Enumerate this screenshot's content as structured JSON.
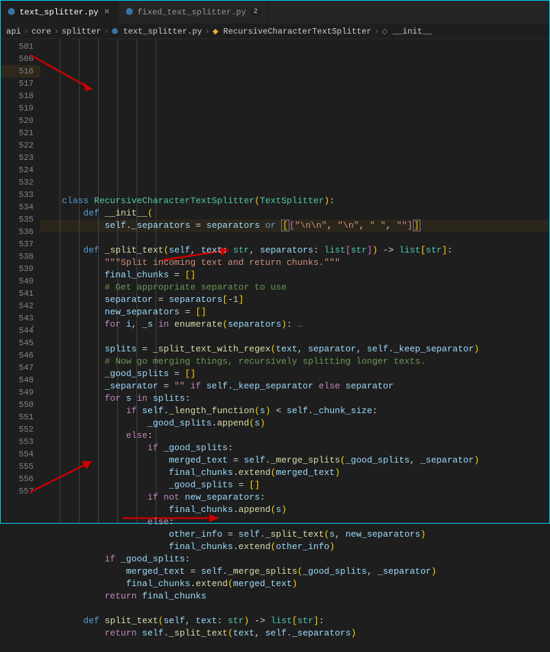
{
  "tabs": [
    {
      "label": "text_splitter.py",
      "active": true,
      "mod": null
    },
    {
      "label": "fixed_text_splitter.py",
      "active": false,
      "mod": "2"
    }
  ],
  "breadcrumbs": [
    {
      "label": "api",
      "icon": null
    },
    {
      "label": "core",
      "icon": null
    },
    {
      "label": "splitter",
      "icon": null
    },
    {
      "label": "text_splitter.py",
      "icon": "py"
    },
    {
      "label": "RecursiveCharacterTextSplitter",
      "icon": "cls"
    },
    {
      "label": "__init__",
      "icon": "fn"
    }
  ],
  "sep": "›",
  "lines": [
    {
      "num": "501",
      "tokens": [
        [
          "    ",
          ""
        ],
        [
          "class ",
          "kw"
        ],
        [
          "RecursiveCharacterTextSplitter",
          "cls"
        ],
        [
          "(",
          "par"
        ],
        [
          "TextSplitter",
          "cls"
        ],
        [
          ")",
          "par"
        ],
        [
          ":",
          "p"
        ]
      ]
    },
    {
      "num": "508",
      "tokens": [
        [
          "        ",
          ""
        ],
        [
          "def ",
          "kw"
        ],
        [
          "__init__",
          "fn"
        ],
        [
          "(",
          "par"
        ]
      ]
    },
    {
      "num": "516",
      "hl": true,
      "tokens": [
        [
          "            ",
          ""
        ],
        [
          "self",
          "v"
        ],
        [
          "._separators",
          "v"
        ],
        [
          " = ",
          "p"
        ],
        [
          "separators",
          "v"
        ],
        [
          " ",
          "p"
        ],
        [
          "or",
          "kw"
        ],
        [
          " ",
          "p"
        ],
        [
          "[",
          "par selbox"
        ],
        [
          "[",
          "par2"
        ],
        [
          "\"",
          "s"
        ],
        [
          "\\n\\n",
          "s"
        ],
        [
          "\"",
          "s"
        ],
        [
          ", ",
          "p"
        ],
        [
          "\"",
          "s"
        ],
        [
          "\\n",
          "s"
        ],
        [
          "\"",
          "s"
        ],
        [
          ", ",
          "p"
        ],
        [
          "\"",
          "s"
        ],
        [
          " ",
          "s"
        ],
        [
          "\"",
          "s"
        ],
        [
          ", ",
          "p"
        ],
        [
          "\"\"",
          "s"
        ],
        [
          "]",
          "par2"
        ],
        [
          "]",
          "par selbox"
        ]
      ]
    },
    {
      "num": "517",
      "tokens": [
        [
          "",
          ""
        ]
      ]
    },
    {
      "num": "518",
      "tokens": [
        [
          "        ",
          ""
        ],
        [
          "def ",
          "kw"
        ],
        [
          "_split_text",
          "fn"
        ],
        [
          "(",
          "par"
        ],
        [
          "self",
          "v"
        ],
        [
          ", ",
          "p"
        ],
        [
          "text",
          "v"
        ],
        [
          ": ",
          "p"
        ],
        [
          "str",
          "cls"
        ],
        [
          ", ",
          "p"
        ],
        [
          "separators",
          "v"
        ],
        [
          ": ",
          "p"
        ],
        [
          "list",
          "cls"
        ],
        [
          "[",
          "par2"
        ],
        [
          "str",
          "cls"
        ],
        [
          "]",
          "par2"
        ],
        [
          ")",
          "par"
        ],
        [
          " -> ",
          "p"
        ],
        [
          "list",
          "cls"
        ],
        [
          "[",
          "par"
        ],
        [
          "str",
          "cls"
        ],
        [
          "]",
          "par"
        ],
        [
          ":",
          "p"
        ]
      ]
    },
    {
      "num": "519",
      "tokens": [
        [
          "            ",
          ""
        ],
        [
          "\"\"\"Split incoming text and return chunks.\"\"\"",
          "s"
        ]
      ]
    },
    {
      "num": "520",
      "tokens": [
        [
          "            ",
          ""
        ],
        [
          "final_chunks",
          "v"
        ],
        [
          " = ",
          "p"
        ],
        [
          "[",
          "par"
        ],
        [
          "]",
          "par"
        ]
      ]
    },
    {
      "num": "521",
      "tokens": [
        [
          "            ",
          ""
        ],
        [
          "# Get appropriate separator to use",
          "c"
        ]
      ]
    },
    {
      "num": "522",
      "tokens": [
        [
          "            ",
          ""
        ],
        [
          "separator",
          "v"
        ],
        [
          " = ",
          "p"
        ],
        [
          "separators",
          "v"
        ],
        [
          "[",
          "par"
        ],
        [
          "-",
          "p"
        ],
        [
          "1",
          "n"
        ],
        [
          "]",
          "par"
        ]
      ]
    },
    {
      "num": "523",
      "tokens": [
        [
          "            ",
          ""
        ],
        [
          "new_separators",
          "v"
        ],
        [
          " = ",
          "p"
        ],
        [
          "[",
          "par"
        ],
        [
          "]",
          "par"
        ]
      ]
    },
    {
      "num": "524",
      "fold": true,
      "tokens": [
        [
          "            ",
          ""
        ],
        [
          "for ",
          "kwc"
        ],
        [
          "i",
          "v"
        ],
        [
          ", ",
          "p"
        ],
        [
          "_s",
          "v"
        ],
        [
          " ",
          "p"
        ],
        [
          "in ",
          "kwc"
        ],
        [
          "enumerate",
          "fn"
        ],
        [
          "(",
          "par"
        ],
        [
          "separators",
          "v"
        ],
        [
          ")",
          "par"
        ],
        [
          ": ",
          "p"
        ],
        [
          "…",
          "c"
        ]
      ]
    },
    {
      "num": "532",
      "tokens": [
        [
          "",
          ""
        ]
      ]
    },
    {
      "num": "533",
      "tokens": [
        [
          "            ",
          ""
        ],
        [
          "splits",
          "v"
        ],
        [
          " = ",
          "p"
        ],
        [
          "_split_text_with_regex",
          "fn"
        ],
        [
          "(",
          "par"
        ],
        [
          "text",
          "v"
        ],
        [
          ", ",
          "p"
        ],
        [
          "separator",
          "v"
        ],
        [
          ", ",
          "p"
        ],
        [
          "self",
          "v"
        ],
        [
          "._keep_separator",
          "v"
        ],
        [
          ")",
          "par"
        ]
      ]
    },
    {
      "num": "534",
      "tokens": [
        [
          "            ",
          ""
        ],
        [
          "# Now go merging things, recursively splitting longer texts.",
          "c"
        ]
      ]
    },
    {
      "num": "535",
      "tokens": [
        [
          "            ",
          ""
        ],
        [
          "_good_splits",
          "v"
        ],
        [
          " = ",
          "p"
        ],
        [
          "[",
          "par"
        ],
        [
          "]",
          "par"
        ]
      ]
    },
    {
      "num": "536",
      "tokens": [
        [
          "            ",
          ""
        ],
        [
          "_separator",
          "v"
        ],
        [
          " = ",
          "p"
        ],
        [
          "\"\"",
          "s"
        ],
        [
          " ",
          "p"
        ],
        [
          "if ",
          "kwc"
        ],
        [
          "self",
          "v"
        ],
        [
          "._keep_separator",
          "v"
        ],
        [
          " ",
          "p"
        ],
        [
          "else ",
          "kwc"
        ],
        [
          "separator",
          "v"
        ]
      ]
    },
    {
      "num": "537",
      "tokens": [
        [
          "            ",
          ""
        ],
        [
          "for ",
          "kwc"
        ],
        [
          "s",
          "v"
        ],
        [
          " ",
          "p"
        ],
        [
          "in ",
          "kwc"
        ],
        [
          "splits",
          "v"
        ],
        [
          ":",
          "p"
        ]
      ]
    },
    {
      "num": "538",
      "tokens": [
        [
          "                ",
          ""
        ],
        [
          "if ",
          "kwc"
        ],
        [
          "self",
          "v"
        ],
        [
          "._length_function",
          "fn"
        ],
        [
          "(",
          "par"
        ],
        [
          "s",
          "v"
        ],
        [
          ")",
          "par"
        ],
        [
          " < ",
          "p"
        ],
        [
          "self",
          "v"
        ],
        [
          "._chunk_size",
          "v"
        ],
        [
          ":",
          "p"
        ]
      ]
    },
    {
      "num": "539",
      "tokens": [
        [
          "                    ",
          ""
        ],
        [
          "_good_splits",
          "v"
        ],
        [
          ".",
          "p"
        ],
        [
          "append",
          "fn"
        ],
        [
          "(",
          "par"
        ],
        [
          "s",
          "v"
        ],
        [
          ")",
          "par"
        ]
      ]
    },
    {
      "num": "540",
      "tokens": [
        [
          "                ",
          ""
        ],
        [
          "else",
          "kwc"
        ],
        [
          ":",
          "p"
        ]
      ]
    },
    {
      "num": "541",
      "tokens": [
        [
          "                    ",
          ""
        ],
        [
          "if ",
          "kwc"
        ],
        [
          "_good_splits",
          "v"
        ],
        [
          ":",
          "p"
        ]
      ]
    },
    {
      "num": "542",
      "tokens": [
        [
          "                        ",
          ""
        ],
        [
          "merged_text",
          "v"
        ],
        [
          " = ",
          "p"
        ],
        [
          "self",
          "v"
        ],
        [
          ".",
          "p"
        ],
        [
          "_merge_splits",
          "fn"
        ],
        [
          "(",
          "par"
        ],
        [
          "_good_splits",
          "v"
        ],
        [
          ", ",
          "p"
        ],
        [
          "_separator",
          "v"
        ],
        [
          ")",
          "par"
        ]
      ]
    },
    {
      "num": "543",
      "tokens": [
        [
          "                        ",
          ""
        ],
        [
          "final_chunks",
          "v"
        ],
        [
          ".",
          "p"
        ],
        [
          "extend",
          "fn"
        ],
        [
          "(",
          "par"
        ],
        [
          "merged_text",
          "v"
        ],
        [
          ")",
          "par"
        ]
      ]
    },
    {
      "num": "544",
      "tokens": [
        [
          "                        ",
          ""
        ],
        [
          "_good_splits",
          "v"
        ],
        [
          " = ",
          "p"
        ],
        [
          "[",
          "par"
        ],
        [
          "]",
          "par"
        ]
      ]
    },
    {
      "num": "545",
      "tokens": [
        [
          "                    ",
          ""
        ],
        [
          "if ",
          "kwc"
        ],
        [
          "not ",
          "kwc"
        ],
        [
          "new_separators",
          "v"
        ],
        [
          ":",
          "p"
        ]
      ]
    },
    {
      "num": "546",
      "tokens": [
        [
          "                        ",
          ""
        ],
        [
          "final_chunks",
          "v"
        ],
        [
          ".",
          "p"
        ],
        [
          "append",
          "fn"
        ],
        [
          "(",
          "par"
        ],
        [
          "s",
          "v"
        ],
        [
          ")",
          "par"
        ]
      ]
    },
    {
      "num": "547",
      "tokens": [
        [
          "                    ",
          ""
        ],
        [
          "else",
          "kwc"
        ],
        [
          ":",
          "p"
        ]
      ]
    },
    {
      "num": "548",
      "tokens": [
        [
          "                        ",
          ""
        ],
        [
          "other_info",
          "v"
        ],
        [
          " = ",
          "p"
        ],
        [
          "self",
          "v"
        ],
        [
          ".",
          "p"
        ],
        [
          "_split_text",
          "fn"
        ],
        [
          "(",
          "par"
        ],
        [
          "s",
          "v"
        ],
        [
          ", ",
          "p"
        ],
        [
          "new_separators",
          "v"
        ],
        [
          ")",
          "par"
        ]
      ]
    },
    {
      "num": "549",
      "tokens": [
        [
          "                        ",
          ""
        ],
        [
          "final_chunks",
          "v"
        ],
        [
          ".",
          "p"
        ],
        [
          "extend",
          "fn"
        ],
        [
          "(",
          "par"
        ],
        [
          "other_info",
          "v"
        ],
        [
          ")",
          "par"
        ]
      ]
    },
    {
      "num": "550",
      "tokens": [
        [
          "            ",
          ""
        ],
        [
          "if ",
          "kwc"
        ],
        [
          "_good_splits",
          "v"
        ],
        [
          ":",
          "p"
        ]
      ]
    },
    {
      "num": "551",
      "tokens": [
        [
          "                ",
          ""
        ],
        [
          "merged_text",
          "v"
        ],
        [
          " = ",
          "p"
        ],
        [
          "self",
          "v"
        ],
        [
          ".",
          "p"
        ],
        [
          "_merge_splits",
          "fn"
        ],
        [
          "(",
          "par"
        ],
        [
          "_good_splits",
          "v"
        ],
        [
          ", ",
          "p"
        ],
        [
          "_separator",
          "v"
        ],
        [
          ")",
          "par"
        ]
      ]
    },
    {
      "num": "552",
      "tokens": [
        [
          "                ",
          ""
        ],
        [
          "final_chunks",
          "v"
        ],
        [
          ".",
          "p"
        ],
        [
          "extend",
          "fn"
        ],
        [
          "(",
          "par"
        ],
        [
          "merged_text",
          "v"
        ],
        [
          ")",
          "par"
        ]
      ]
    },
    {
      "num": "553",
      "tokens": [
        [
          "            ",
          ""
        ],
        [
          "return ",
          "kwc"
        ],
        [
          "final_chunks",
          "v"
        ]
      ]
    },
    {
      "num": "554",
      "tokens": [
        [
          "",
          ""
        ]
      ]
    },
    {
      "num": "555",
      "tokens": [
        [
          "        ",
          ""
        ],
        [
          "def ",
          "kw"
        ],
        [
          "split_text",
          "fn"
        ],
        [
          "(",
          "par"
        ],
        [
          "self",
          "v"
        ],
        [
          ", ",
          "p"
        ],
        [
          "text",
          "v"
        ],
        [
          ": ",
          "p"
        ],
        [
          "str",
          "cls"
        ],
        [
          ")",
          "par"
        ],
        [
          " -> ",
          "p"
        ],
        [
          "list",
          "cls"
        ],
        [
          "[",
          "par"
        ],
        [
          "str",
          "cls"
        ],
        [
          "]",
          "par"
        ],
        [
          ":",
          "p"
        ]
      ]
    },
    {
      "num": "556",
      "tokens": [
        [
          "            ",
          ""
        ],
        [
          "return ",
          "kwc"
        ],
        [
          "self",
          "v"
        ],
        [
          ".",
          "p"
        ],
        [
          "_split_text",
          "fn"
        ],
        [
          "(",
          "par"
        ],
        [
          "text",
          "v"
        ],
        [
          ", ",
          "p"
        ],
        [
          "self",
          "v"
        ],
        [
          "._separators",
          "v"
        ],
        [
          ")",
          "par"
        ]
      ]
    },
    {
      "num": "557",
      "tokens": [
        [
          "",
          ""
        ]
      ]
    }
  ]
}
